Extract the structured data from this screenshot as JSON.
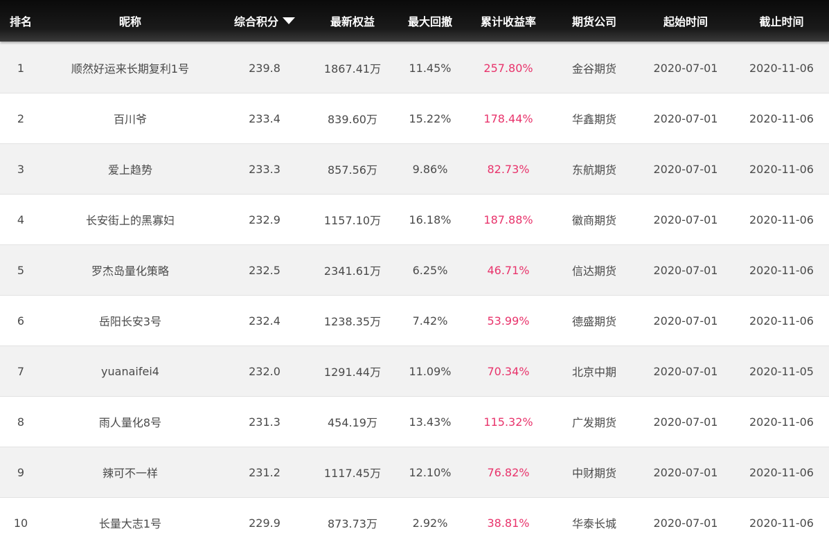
{
  "header": {
    "rank": "排名",
    "nickname": "昵称",
    "score": "综合积分",
    "equity": "最新权益",
    "drawdown": "最大回撤",
    "return": "累计收益率",
    "company": "期货公司",
    "start": "起始时间",
    "end": "截止时间",
    "sort_icon": "triangle-down-icon"
  },
  "colors": {
    "return_text": "#e8336b",
    "header_bg": "#111111",
    "row_alt": "#f2f2f2"
  },
  "rows": [
    {
      "rank": "1",
      "nickname": "顺然好运来长期复利1号",
      "score": "239.8",
      "equity": "1867.41万",
      "drawdown": "11.45%",
      "return": "257.80%",
      "company": "金谷期货",
      "start": "2020-07-01",
      "end": "2020-11-06"
    },
    {
      "rank": "2",
      "nickname": "百川爷",
      "score": "233.4",
      "equity": "839.60万",
      "drawdown": "15.22%",
      "return": "178.44%",
      "company": "华鑫期货",
      "start": "2020-07-01",
      "end": "2020-11-06"
    },
    {
      "rank": "3",
      "nickname": "爱上趋势",
      "score": "233.3",
      "equity": "857.56万",
      "drawdown": "9.86%",
      "return": "82.73%",
      "company": "东航期货",
      "start": "2020-07-01",
      "end": "2020-11-06"
    },
    {
      "rank": "4",
      "nickname": "长安街上的黑寡妇",
      "score": "232.9",
      "equity": "1157.10万",
      "drawdown": "16.18%",
      "return": "187.88%",
      "company": "徽商期货",
      "start": "2020-07-01",
      "end": "2020-11-06"
    },
    {
      "rank": "5",
      "nickname": "罗杰岛量化策略",
      "score": "232.5",
      "equity": "2341.61万",
      "drawdown": "6.25%",
      "return": "46.71%",
      "company": "信达期货",
      "start": "2020-07-01",
      "end": "2020-11-06"
    },
    {
      "rank": "6",
      "nickname": "岳阳长安3号",
      "score": "232.4",
      "equity": "1238.35万",
      "drawdown": "7.42%",
      "return": "53.99%",
      "company": "德盛期货",
      "start": "2020-07-01",
      "end": "2020-11-06"
    },
    {
      "rank": "7",
      "nickname": "yuanaifei4",
      "score": "232.0",
      "equity": "1291.44万",
      "drawdown": "11.09%",
      "return": "70.34%",
      "company": "北京中期",
      "start": "2020-07-01",
      "end": "2020-11-05"
    },
    {
      "rank": "8",
      "nickname": "雨人量化8号",
      "score": "231.3",
      "equity": "454.19万",
      "drawdown": "13.43%",
      "return": "115.32%",
      "company": "广发期货",
      "start": "2020-07-01",
      "end": "2020-11-06"
    },
    {
      "rank": "9",
      "nickname": "辣可不一样",
      "score": "231.2",
      "equity": "1117.45万",
      "drawdown": "12.10%",
      "return": "76.82%",
      "company": "中财期货",
      "start": "2020-07-01",
      "end": "2020-11-06"
    },
    {
      "rank": "10",
      "nickname": "长量大志1号",
      "score": "229.9",
      "equity": "873.73万",
      "drawdown": "2.92%",
      "return": "38.81%",
      "company": "华泰长城",
      "start": "2020-07-01",
      "end": "2020-11-06"
    }
  ]
}
